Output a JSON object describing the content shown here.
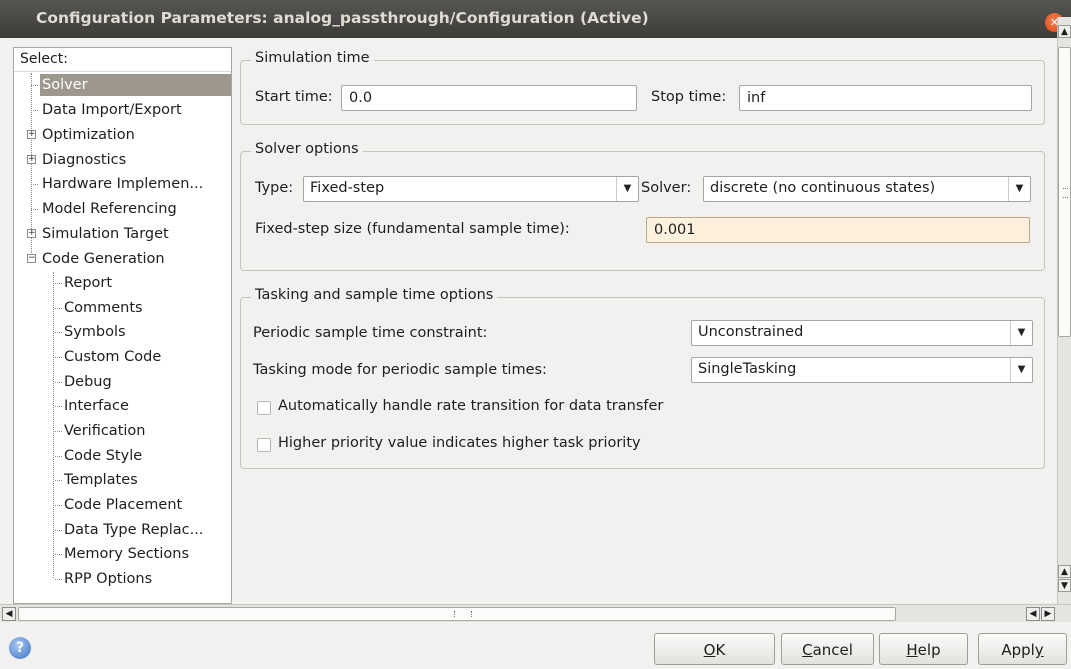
{
  "window": {
    "title": "Configuration Parameters: analog_passthrough/Configuration (Active)"
  },
  "tree": {
    "header": "Select:",
    "items": [
      {
        "label": "Solver",
        "selected": true
      },
      {
        "label": "Data Import/Export"
      },
      {
        "label": "Optimization",
        "expandable": true
      },
      {
        "label": "Diagnostics",
        "expandable": true
      },
      {
        "label": "Hardware Implemen..."
      },
      {
        "label": "Model Referencing"
      },
      {
        "label": "Simulation Target",
        "expandable": true
      },
      {
        "label": "Code Generation",
        "expanded": true
      },
      {
        "label": "Report"
      },
      {
        "label": "Comments"
      },
      {
        "label": "Symbols"
      },
      {
        "label": "Custom Code"
      },
      {
        "label": "Debug"
      },
      {
        "label": "Interface"
      },
      {
        "label": "Verification"
      },
      {
        "label": "Code Style"
      },
      {
        "label": "Templates"
      },
      {
        "label": "Code Placement"
      },
      {
        "label": "Data Type Replac..."
      },
      {
        "label": "Memory Sections"
      },
      {
        "label": "RPP Options"
      }
    ]
  },
  "simulation_time": {
    "title": "Simulation time",
    "start_label": "Start time:",
    "start_value": "0.0",
    "stop_label": "Stop time:",
    "stop_value": "inf"
  },
  "solver_options": {
    "title": "Solver options",
    "type_label": "Type:",
    "type_value": "Fixed-step",
    "solver_label": "Solver:",
    "solver_value": "discrete (no continuous states)",
    "step_label": "Fixed-step size (fundamental sample time):",
    "step_value": "0.001"
  },
  "tasking": {
    "title": "Tasking and sample time options",
    "periodic_label": "Periodic sample time constraint:",
    "periodic_value": "Unconstrained",
    "mode_label": "Tasking mode for periodic sample times:",
    "mode_value": "SingleTasking",
    "auto_rate_label": "Automatically handle rate transition for data transfer",
    "auto_rate_checked": false,
    "priority_label": "Higher priority value indicates higher task priority",
    "priority_checked": false
  },
  "buttons": {
    "ok_pre": "",
    "ok_u": "O",
    "ok_post": "K",
    "cancel_pre": "",
    "cancel_u": "C",
    "cancel_post": "ancel",
    "help_pre": "",
    "help_u": "H",
    "help_post": "elp",
    "apply_pre": "Appl",
    "apply_u": "y",
    "apply_post": ""
  },
  "icons": {
    "close": "close-icon",
    "help": "help-icon",
    "combo": "chevron-down-icon"
  }
}
